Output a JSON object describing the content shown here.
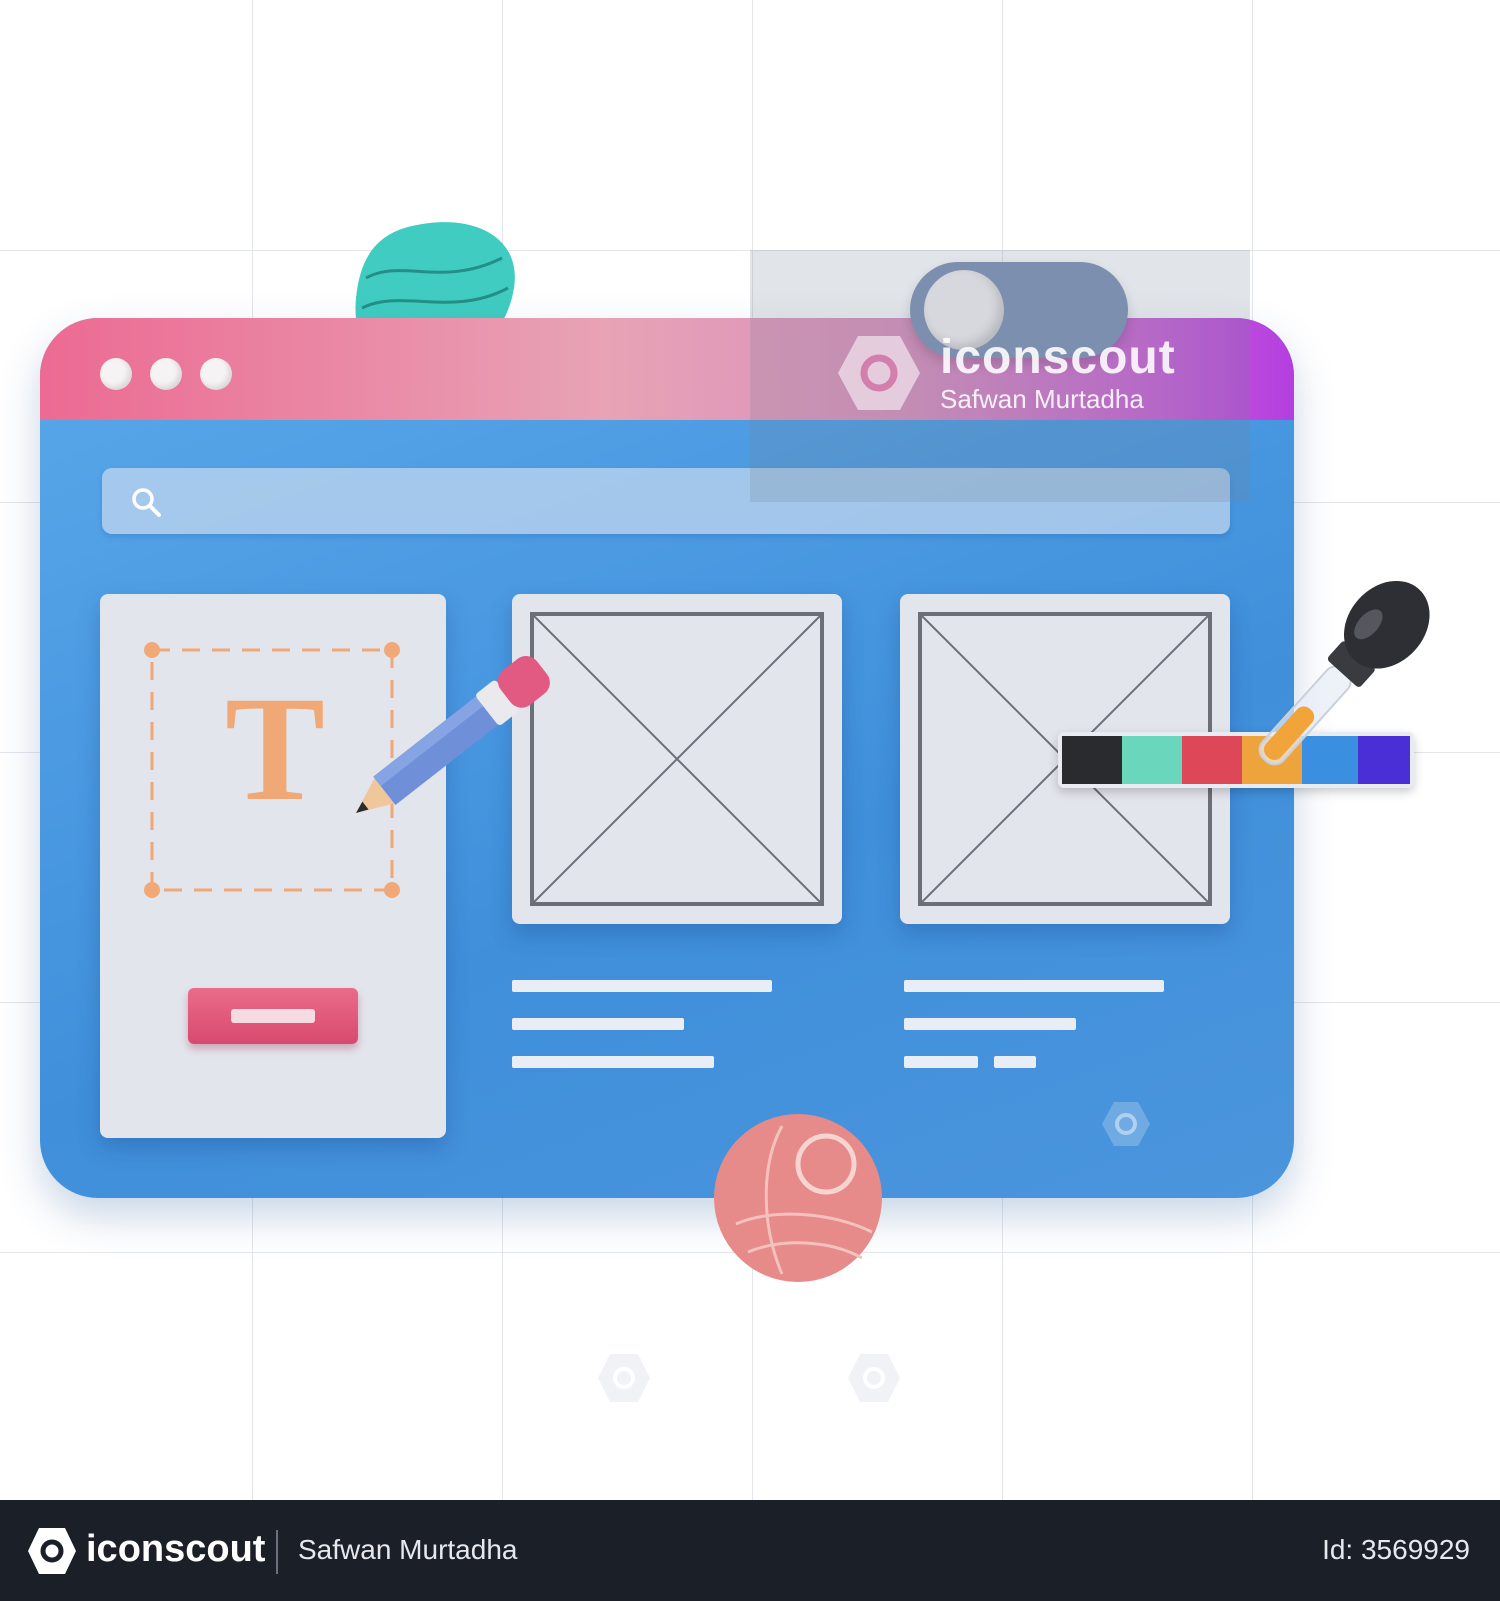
{
  "watermark": {
    "brand": "iconscout",
    "author": "Safwan Murtadha"
  },
  "footer": {
    "brand": "iconscout",
    "author": "Safwan Murtadha",
    "id_label": "Id: 3569929"
  },
  "canvas": {
    "text_tool_letter": "T"
  },
  "palette": {
    "colors": [
      "#2a2b2e",
      "#6ad6bc",
      "#de4757",
      "#eda43c",
      "#3b8fe0",
      "#4a2fd6"
    ]
  },
  "icons": {
    "search": "search-icon",
    "pencil": "pencil-icon",
    "eyedropper": "eyedropper-icon",
    "logo": "iconscout-logo-icon"
  }
}
